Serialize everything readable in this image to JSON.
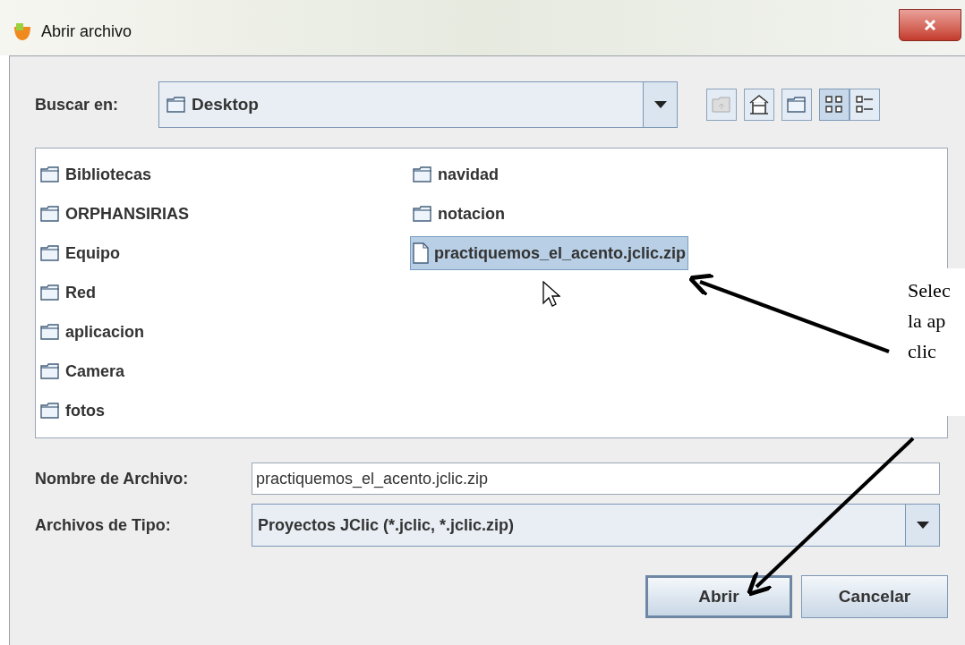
{
  "window": {
    "title": "Abrir archivo"
  },
  "look_in": {
    "label": "Buscar en:",
    "value": "Desktop"
  },
  "files": [
    {
      "name": "Bibliotecas",
      "kind": "folder",
      "selected": false
    },
    {
      "name": "ORPHANSIRIAS",
      "kind": "folder",
      "selected": false
    },
    {
      "name": "Equipo",
      "kind": "folder",
      "selected": false
    },
    {
      "name": "Red",
      "kind": "folder",
      "selected": false
    },
    {
      "name": "aplicacion",
      "kind": "folder",
      "selected": false
    },
    {
      "name": "Camera",
      "kind": "folder",
      "selected": false
    },
    {
      "name": "fotos",
      "kind": "folder",
      "selected": false
    },
    {
      "name": "navidad",
      "kind": "folder",
      "selected": false
    },
    {
      "name": "notacion",
      "kind": "folder",
      "selected": false
    },
    {
      "name": "practiquemos_el_acento.jclic.zip",
      "kind": "file",
      "selected": true
    }
  ],
  "file_name": {
    "label": "Nombre de Archivo:",
    "value": "practiquemos_el_acento.jclic.zip"
  },
  "file_type": {
    "label": "Archivos de Tipo:",
    "value": "Proyectos JClic (*.jclic, *.jclic.zip)"
  },
  "buttons": [
    {
      "label": "Abrir",
      "default": true
    },
    {
      "label": "Cancelar",
      "default": false
    }
  ],
  "callout": {
    "lines": [
      "Selec",
      "la ap",
      "clic"
    ]
  }
}
